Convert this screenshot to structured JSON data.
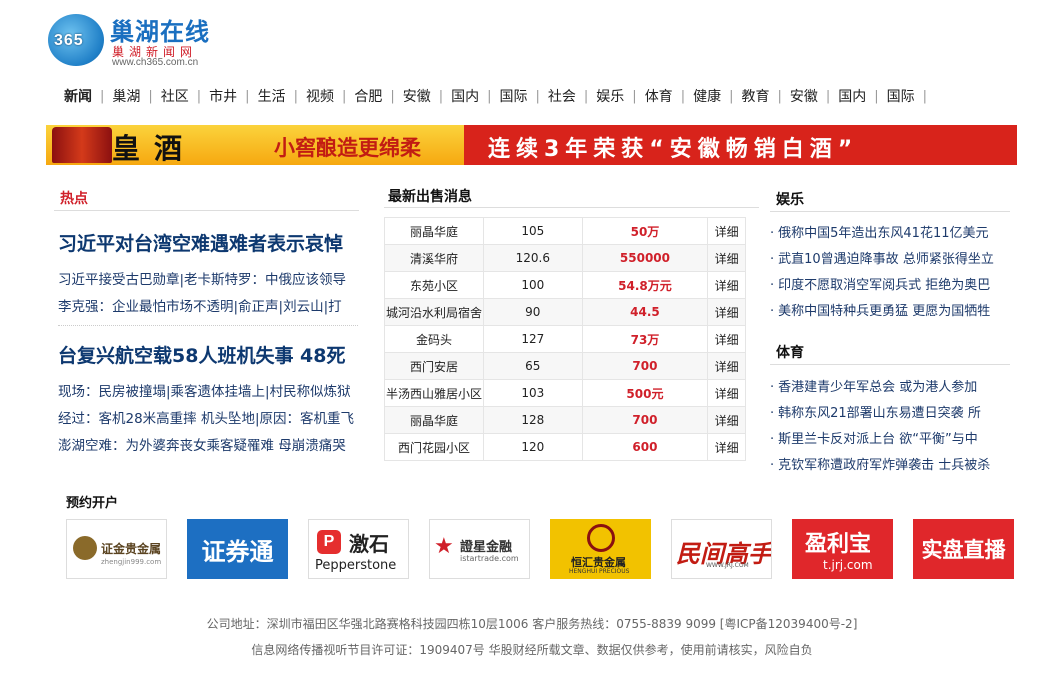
{
  "logo": {
    "badge": "365",
    "title": "巢湖在线",
    "subtitle": "巢湖新闻网",
    "url": "www.ch365.com.cn"
  },
  "nav": [
    "新闻",
    "巢湖",
    "社区",
    "市井",
    "生活",
    "视频",
    "合肥",
    "安徽",
    "国内",
    "国际",
    "社会",
    "娱乐",
    "体育",
    "健康",
    "教育",
    "安徽",
    "国内",
    "国际"
  ],
  "banner": {
    "brand": "皇酒",
    "slogan": "小窖酿造更绵柔",
    "headline": "连续3年荣获“安徽畅销白酒”"
  },
  "hot": {
    "heading": "热点",
    "stories": [
      {
        "title": "习近平对台湾空难遇难者表示哀悼",
        "lines": [
          "习近平接受古巴勋章|老卡斯特罗：中俄应该领导",
          "李克强：企业最怕市场不透明|俞正声|刘云山|打"
        ]
      },
      {
        "title": "台复兴航空载58人班机失事 48死",
        "lines": [
          "现场：民房被撞塌|乘客遗体挂墙上|村民称似炼狱",
          "经过：客机28米高重摔 机头坠地|原因：客机重飞",
          "澎湖空难：为外婆奔丧女乘客疑罹难 母崩溃痛哭"
        ]
      }
    ]
  },
  "sale": {
    "heading": "最新出售消息",
    "rows": [
      {
        "name": "丽晶华庭",
        "area": "105",
        "price": "50万",
        "detail": "详细"
      },
      {
        "name": "清溪华府",
        "area": "120.6",
        "price": "550000",
        "detail": "详细"
      },
      {
        "name": "东苑小区",
        "area": "100",
        "price": "54.8万元",
        "detail": "详细"
      },
      {
        "name": "城河沿水利局宿舍",
        "area": "90",
        "price": "44.5",
        "detail": "详细"
      },
      {
        "name": "金码头",
        "area": "127",
        "price": "73万",
        "detail": "详细"
      },
      {
        "name": "西门安居",
        "area": "65",
        "price": "700",
        "detail": "详细"
      },
      {
        "name": "半汤西山雅居小区",
        "area": "103",
        "price": "500元",
        "detail": "详细"
      },
      {
        "name": "丽晶华庭",
        "area": "128",
        "price": "700",
        "detail": "详细"
      },
      {
        "name": "西门花园小区",
        "area": "120",
        "price": "600",
        "detail": "详细"
      }
    ]
  },
  "ent": {
    "heading": "娱乐",
    "items": [
      "俄称中国5年造出东风41花11亿美元",
      "武直10曾遇迫降事故 总师紧张得坐立",
      "印度不愿取消空军阅兵式 拒绝为奥巴",
      "美称中国特种兵更勇猛 更愿为国牺牲"
    ]
  },
  "sports": {
    "heading": "体育",
    "items": [
      "香港建青少年军总会 或为港人参加",
      "韩称东风21部署山东易遭日突袭 所",
      "斯里兰卡反对派上台 欲“平衡”与中",
      "克钦军称遭政府军炸弹袭击 士兵被杀"
    ]
  },
  "partners": {
    "heading": "预约开户",
    "logos": [
      {
        "name": "证金贵金属",
        "sub": "zhengjin999.com"
      },
      {
        "name": "证券通"
      },
      {
        "name": "激石",
        "sub": "Pepperstone"
      },
      {
        "name": "證星金融",
        "sub": "istartrade.com"
      },
      {
        "name": "恒汇贵金属",
        "sub": "HENGHUI PRECIOUS"
      },
      {
        "name": "民间高手",
        "sub": "WWW.JRJ.COM"
      },
      {
        "name": "盈利宝",
        "sub": "t.jrj.com"
      },
      {
        "name": "实盘直播"
      }
    ]
  },
  "footer": {
    "line1": "公司地址：深圳市福田区华强北路赛格科技园四栋10层1006   客户服务热线：0755-8839 9099  [粤ICP备12039400号-2]",
    "line2": "信息网络传播视听节目许可证：1909407号   华股财经所载文章、数据仅供参考，使用前请核实，风险自负"
  },
  "colors": {
    "brand_blue": "#1a6fc0",
    "accent_red": "#d0202a",
    "banner_yellow": "#f6a810",
    "banner_red": "#d8231b"
  }
}
